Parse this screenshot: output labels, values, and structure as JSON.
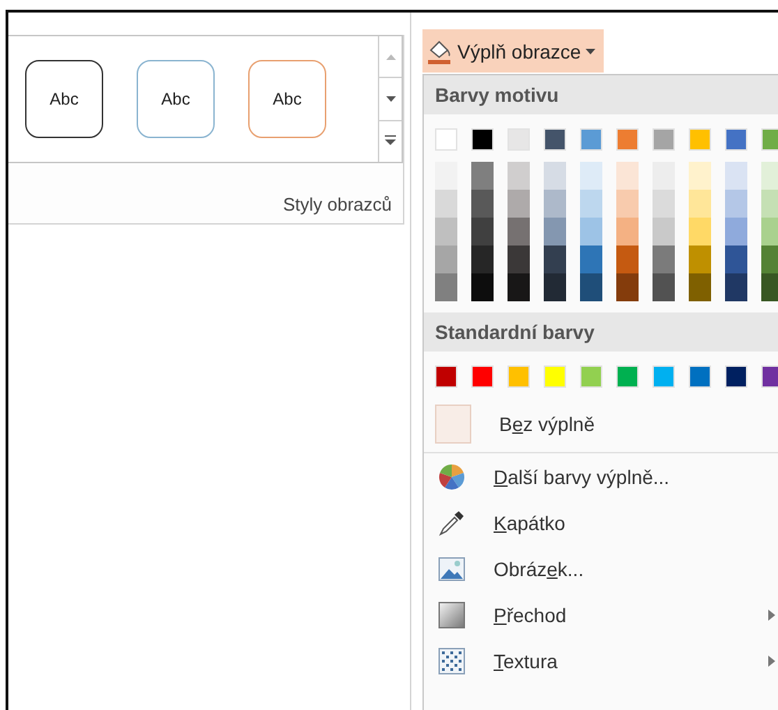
{
  "gallery": {
    "styles": [
      {
        "label": "Abc",
        "color": "#333333"
      },
      {
        "label": "Abc",
        "color": "#8ab4d0"
      },
      {
        "label": "Abc",
        "color": "#e8a070"
      }
    ],
    "group_label": "Styly obrazců"
  },
  "fill_button": {
    "label": "Výplň obrazce",
    "expanded": true
  },
  "dropdown": {
    "theme_header": "Barvy motivu",
    "theme_colors": [
      {
        "color": "#ffffff",
        "shades": [
          {
            "color": "#f2f2f2"
          },
          {
            "color": "#d9d9d9"
          },
          {
            "color": "#bfbfbf"
          },
          {
            "color": "#a6a6a6"
          },
          {
            "color": "#808080"
          }
        ]
      },
      {
        "color": "#000000",
        "shades": [
          {
            "color": "#7f7f7f"
          },
          {
            "color": "#595959"
          },
          {
            "color": "#404040"
          },
          {
            "color": "#262626"
          },
          {
            "color": "#0d0d0d"
          }
        ]
      },
      {
        "color": "#e7e6e6",
        "shades": [
          {
            "color": "#d0cece"
          },
          {
            "color": "#aeaaaa"
          },
          {
            "color": "#767171"
          },
          {
            "color": "#3b3838"
          },
          {
            "color": "#181717"
          }
        ]
      },
      {
        "color": "#44546a",
        "shades": [
          {
            "color": "#d6dce5"
          },
          {
            "color": "#adb9ca"
          },
          {
            "color": "#8497b0"
          },
          {
            "color": "#333f50"
          },
          {
            "color": "#222a35"
          }
        ]
      },
      {
        "color": "#5b9bd5",
        "shades": [
          {
            "color": "#deebf7"
          },
          {
            "color": "#bdd7ee"
          },
          {
            "color": "#9dc3e6"
          },
          {
            "color": "#2e75b6"
          },
          {
            "color": "#1f4e79"
          }
        ]
      },
      {
        "color": "#ed7d31",
        "shades": [
          {
            "color": "#fbe5d6"
          },
          {
            "color": "#f8cbad"
          },
          {
            "color": "#f4b183"
          },
          {
            "color": "#c55a11"
          },
          {
            "color": "#843c0c"
          }
        ]
      },
      {
        "color": "#a5a5a5",
        "shades": [
          {
            "color": "#ededed"
          },
          {
            "color": "#dbdbdb"
          },
          {
            "color": "#c9c9c9"
          },
          {
            "color": "#7b7b7b"
          },
          {
            "color": "#525252"
          }
        ]
      },
      {
        "color": "#ffc000",
        "shades": [
          {
            "color": "#fff2cc"
          },
          {
            "color": "#ffe699"
          },
          {
            "color": "#ffd966"
          },
          {
            "color": "#bf9000"
          },
          {
            "color": "#7f6000"
          }
        ]
      },
      {
        "color": "#4472c4",
        "shades": [
          {
            "color": "#dae3f3"
          },
          {
            "color": "#b4c7e7"
          },
          {
            "color": "#8faadc"
          },
          {
            "color": "#2f5597"
          },
          {
            "color": "#203864"
          }
        ]
      },
      {
        "color": "#70ad47",
        "shades": [
          {
            "color": "#e2f0d9"
          },
          {
            "color": "#c5e0b4"
          },
          {
            "color": "#a9d18e"
          },
          {
            "color": "#548235"
          },
          {
            "color": "#385723"
          }
        ]
      }
    ],
    "standard_header": "Standardní barvy",
    "standard_colors": [
      {
        "color": "#c00000"
      },
      {
        "color": "#ff0000"
      },
      {
        "color": "#ffc000"
      },
      {
        "color": "#ffff00"
      },
      {
        "color": "#92d050"
      },
      {
        "color": "#00b050"
      },
      {
        "color": "#00b0f0"
      },
      {
        "color": "#0070c0"
      },
      {
        "color": "#002060"
      },
      {
        "color": "#7030a0"
      }
    ],
    "no_fill": {
      "label": [
        {
          "text": "B",
          "underline": false
        },
        {
          "text": "e",
          "underline": true
        },
        {
          "text": "z výplně",
          "underline": false
        }
      ]
    },
    "items": [
      {
        "kind": "palette",
        "label": [
          {
            "text": "D",
            "underline": true
          },
          {
            "text": "alší barvy výplně...",
            "underline": false
          }
        ],
        "submenu": false
      },
      {
        "kind": "eyedropper",
        "label": [
          {
            "text": "K",
            "underline": true
          },
          {
            "text": "apátko",
            "underline": false
          }
        ],
        "submenu": false
      },
      {
        "kind": "image",
        "label": [
          {
            "text": "Obráz",
            "underline": false
          },
          {
            "text": "e",
            "underline": true
          },
          {
            "text": "k...",
            "underline": false
          }
        ],
        "submenu": false
      },
      {
        "kind": "gradient",
        "label": [
          {
            "text": "P",
            "underline": true
          },
          {
            "text": "řechod",
            "underline": false
          }
        ],
        "submenu": true
      },
      {
        "kind": "texture",
        "label": [
          {
            "text": "T",
            "underline": true
          },
          {
            "text": "extura",
            "underline": false
          }
        ],
        "submenu": true
      }
    ]
  }
}
